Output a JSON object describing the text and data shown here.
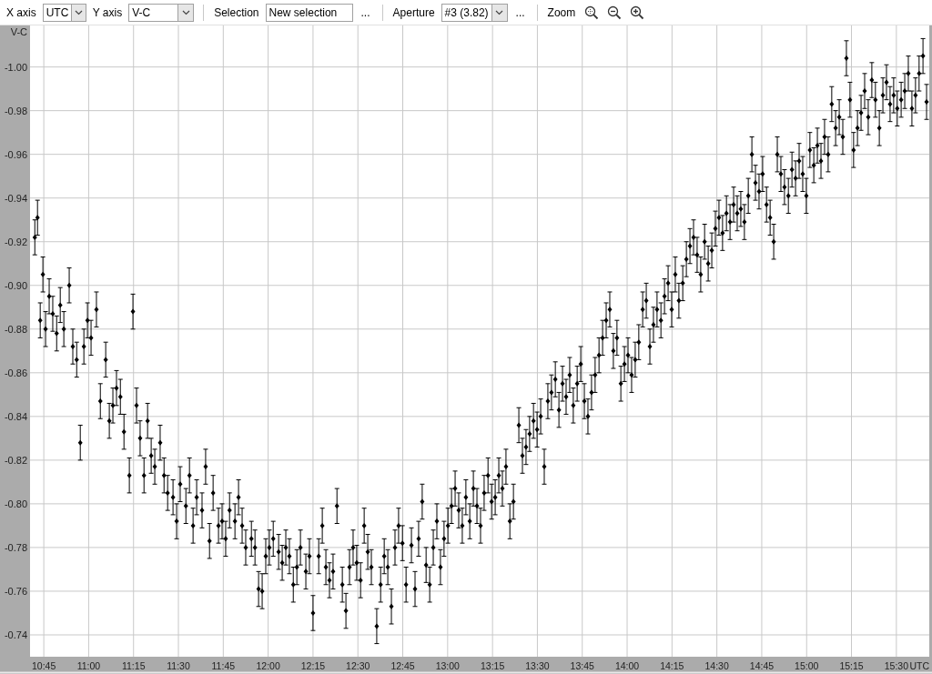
{
  "toolbar": {
    "x_axis": {
      "label": "X axis",
      "value": "UTC"
    },
    "y_axis": {
      "label": "Y axis",
      "value": "V-C"
    },
    "selection": {
      "label": "Selection",
      "value": "New selection",
      "more": "..."
    },
    "aperture": {
      "label": "Aperture",
      "value": "#3 (3.82)",
      "more": "..."
    },
    "zoom": {
      "label": "Zoom"
    }
  },
  "chart": {
    "chart_data": {
      "type": "scatter",
      "xlabel": "UTC",
      "ylabel": "V-C",
      "xlim": [
        640.4,
        941
      ],
      "ylim": [
        -0.73,
        -1.019
      ],
      "grid": true,
      "xticks": [
        {
          "value": 645,
          "label": "10:45"
        },
        {
          "value": 660,
          "label": "11:00"
        },
        {
          "value": 675,
          "label": "11:15"
        },
        {
          "value": 690,
          "label": "11:30"
        },
        {
          "value": 705,
          "label": "11:45"
        },
        {
          "value": 720,
          "label": "12:00"
        },
        {
          "value": 735,
          "label": "12:15"
        },
        {
          "value": 750,
          "label": "12:30"
        },
        {
          "value": 765,
          "label": "12:45"
        },
        {
          "value": 780,
          "label": "13:00"
        },
        {
          "value": 795,
          "label": "13:15"
        },
        {
          "value": 810,
          "label": "13:30"
        },
        {
          "value": 825,
          "label": "13:45"
        },
        {
          "value": 840,
          "label": "14:00"
        },
        {
          "value": 855,
          "label": "14:15"
        },
        {
          "value": 870,
          "label": "14:30"
        },
        {
          "value": 885,
          "label": "14:45"
        },
        {
          "value": 900,
          "label": "15:00"
        },
        {
          "value": 915,
          "label": "15:15"
        },
        {
          "value": 930,
          "label": "15:30"
        }
      ],
      "yticks": [
        {
          "value": -1.0,
          "label": "-1.00"
        },
        {
          "value": -0.98,
          "label": "-0.98"
        },
        {
          "value": -0.96,
          "label": "-0.96"
        },
        {
          "value": -0.94,
          "label": "-0.94"
        },
        {
          "value": -0.92,
          "label": "-0.92"
        },
        {
          "value": -0.9,
          "label": "-0.90"
        },
        {
          "value": -0.88,
          "label": "-0.88"
        },
        {
          "value": -0.86,
          "label": "-0.86"
        },
        {
          "value": -0.84,
          "label": "-0.84"
        },
        {
          "value": -0.82,
          "label": "-0.82"
        },
        {
          "value": -0.8,
          "label": "-0.80"
        },
        {
          "value": -0.78,
          "label": "-0.78"
        },
        {
          "value": -0.76,
          "label": "-0.76"
        },
        {
          "value": -0.74,
          "label": "-0.74"
        }
      ],
      "x": [
        642.0,
        642.9,
        643.8,
        644.7,
        645.6,
        646.8,
        648.0,
        649.3,
        650.5,
        651.7,
        653.5,
        654.7,
        656.0,
        657.2,
        658.4,
        659.6,
        660.8,
        662.6,
        663.9,
        665.7,
        666.9,
        668.1,
        669.3,
        670.6,
        671.8,
        673.6,
        674.8,
        676.0,
        677.2,
        678.5,
        679.7,
        680.9,
        682.1,
        683.9,
        685.2,
        686.4,
        688.2,
        689.4,
        690.6,
        692.5,
        693.7,
        694.9,
        696.1,
        697.9,
        699.1,
        700.4,
        701.6,
        703.4,
        704.6,
        705.8,
        707.1,
        708.9,
        710.1,
        711.3,
        712.5,
        714.4,
        715.6,
        716.8,
        718.0,
        719.2,
        720.4,
        721.7,
        723.5,
        724.7,
        725.9,
        727.1,
        728.4,
        729.6,
        730.8,
        732.6,
        733.8,
        735.0,
        736.9,
        738.1,
        739.3,
        740.5,
        741.7,
        743.0,
        744.8,
        746.0,
        747.2,
        748.4,
        749.6,
        750.9,
        752.1,
        753.3,
        754.5,
        756.3,
        757.6,
        758.8,
        760.0,
        761.2,
        762.4,
        763.6,
        764.9,
        766.1,
        767.9,
        769.1,
        770.3,
        771.5,
        772.8,
        774.0,
        775.2,
        776.4,
        777.6,
        778.8,
        780.1,
        781.3,
        782.5,
        783.7,
        784.9,
        786.1,
        787.4,
        788.6,
        789.8,
        791.0,
        792.2,
        793.5,
        794.7,
        795.9,
        797.1,
        798.3,
        799.5,
        800.8,
        802.0,
        803.8,
        805.0,
        806.2,
        807.4,
        808.7,
        809.9,
        811.1,
        812.3,
        813.5,
        814.7,
        816.0,
        817.2,
        818.4,
        819.6,
        820.8,
        822.0,
        823.3,
        824.5,
        825.7,
        826.9,
        828.1,
        829.3,
        830.6,
        831.8,
        833.0,
        834.2,
        835.4,
        836.6,
        837.9,
        839.1,
        840.3,
        841.5,
        842.7,
        843.9,
        845.2,
        846.4,
        847.6,
        848.8,
        850.0,
        851.3,
        852.5,
        853.7,
        854.9,
        856.1,
        857.3,
        858.6,
        859.8,
        861.0,
        862.2,
        863.4,
        864.6,
        865.9,
        867.1,
        868.3,
        869.5,
        870.7,
        871.9,
        873.2,
        874.4,
        875.6,
        876.8,
        878.0,
        879.2,
        880.5,
        881.7,
        882.9,
        884.1,
        885.3,
        886.6,
        887.8,
        889.0,
        890.2,
        891.4,
        892.6,
        893.9,
        895.1,
        896.3,
        897.5,
        898.7,
        899.9,
        901.1,
        902.4,
        903.6,
        904.8,
        906.0,
        907.2,
        908.4,
        909.7,
        910.9,
        912.1,
        913.3,
        914.5,
        915.7,
        917.0,
        918.2,
        919.4,
        920.6,
        921.8,
        923.0,
        924.3,
        925.5,
        926.7,
        927.9,
        929.1,
        930.3,
        931.6,
        932.8,
        934.0,
        935.2,
        936.4,
        937.6,
        938.9,
        940.1
      ],
      "series": [
        {
          "color": "#000000",
          "errors": [
            0.008,
            0.008,
            0.008,
            0.008,
            0.008,
            0.008,
            0.008,
            0.008,
            0.008,
            0.008,
            0.008,
            0.008,
            0.008,
            0.008,
            0.008,
            0.008,
            0.008,
            0.008,
            0.008,
            0.008,
            0.008,
            0.008,
            0.008,
            0.008,
            0.008,
            0.008,
            0.008,
            0.008,
            0.008,
            0.008,
            0.008,
            0.008,
            0.008,
            0.008,
            0.008,
            0.008,
            0.008,
            0.008,
            0.008,
            0.008,
            0.008,
            0.008,
            0.008,
            0.008,
            0.008,
            0.008,
            0.008,
            0.008,
            0.008,
            0.008,
            0.008,
            0.008,
            0.008,
            0.008,
            0.008,
            0.008,
            0.008,
            0.008,
            0.008,
            0.008,
            0.008,
            0.008,
            0.008,
            0.008,
            0.008,
            0.008,
            0.008,
            0.008,
            0.008,
            0.008,
            0.008,
            0.008,
            0.008,
            0.008,
            0.008,
            0.008,
            0.008,
            0.008,
            0.008,
            0.008,
            0.008,
            0.008,
            0.008,
            0.008,
            0.008,
            0.008,
            0.008,
            0.008,
            0.008,
            0.008,
            0.008,
            0.008,
            0.008,
            0.008,
            0.008,
            0.008,
            0.008,
            0.008,
            0.008,
            0.008,
            0.008,
            0.008,
            0.008,
            0.008,
            0.008,
            0.008,
            0.008,
            0.008,
            0.008,
            0.008,
            0.008,
            0.008,
            0.008,
            0.008,
            0.008,
            0.008,
            0.008,
            0.008,
            0.008,
            0.008,
            0.008,
            0.008,
            0.008,
            0.008,
            0.008,
            0.008,
            0.008,
            0.008,
            0.008,
            0.008,
            0.008,
            0.008,
            0.008,
            0.008,
            0.008,
            0.008,
            0.008,
            0.008,
            0.008,
            0.008,
            0.008,
            0.008,
            0.008,
            0.008,
            0.008,
            0.008,
            0.008,
            0.008,
            0.008,
            0.008,
            0.008,
            0.008,
            0.008,
            0.008,
            0.008,
            0.008,
            0.008,
            0.008,
            0.008,
            0.008,
            0.008,
            0.008,
            0.008,
            0.008,
            0.008,
            0.008,
            0.008,
            0.008,
            0.008,
            0.008,
            0.008,
            0.008,
            0.008,
            0.008,
            0.008,
            0.008,
            0.008,
            0.008,
            0.008,
            0.008,
            0.008,
            0.008,
            0.008,
            0.008,
            0.008,
            0.008,
            0.008,
            0.008,
            0.008,
            0.008,
            0.008,
            0.008,
            0.008,
            0.008,
            0.008,
            0.008,
            0.008,
            0.008,
            0.008,
            0.008,
            0.008,
            0.008,
            0.008,
            0.008,
            0.008,
            0.008,
            0.008,
            0.008,
            0.008,
            0.008,
            0.008,
            0.008,
            0.008,
            0.008,
            0.008,
            0.008,
            0.008,
            0.008,
            0.008,
            0.008,
            0.008,
            0.008,
            0.008,
            0.008,
            0.008,
            0.008,
            0.008,
            0.008,
            0.008,
            0.008,
            0.008,
            0.008,
            0.008,
            0.008,
            0.008,
            0.008,
            0.008,
            0.008
          ],
          "values": [
            -0.922,
            -0.931,
            -0.884,
            -0.905,
            -0.88,
            -0.895,
            -0.887,
            -0.878,
            -0.891,
            -0.88,
            -0.9,
            -0.872,
            -0.866,
            -0.828,
            -0.872,
            -0.884,
            -0.876,
            -0.889,
            -0.847,
            -0.866,
            -0.838,
            -0.845,
            -0.853,
            -0.849,
            -0.833,
            -0.813,
            -0.888,
            -0.845,
            -0.83,
            -0.813,
            -0.838,
            -0.822,
            -0.817,
            -0.828,
            -0.813,
            -0.805,
            -0.803,
            -0.792,
            -0.809,
            -0.799,
            -0.813,
            -0.79,
            -0.803,
            -0.797,
            -0.817,
            -0.783,
            -0.805,
            -0.79,
            -0.792,
            -0.784,
            -0.797,
            -0.792,
            -0.803,
            -0.79,
            -0.78,
            -0.784,
            -0.78,
            -0.761,
            -0.76,
            -0.776,
            -0.78,
            -0.784,
            -0.778,
            -0.773,
            -0.78,
            -0.776,
            -0.763,
            -0.771,
            -0.78,
            -0.769,
            -0.776,
            -0.75,
            -0.776,
            -0.79,
            -0.771,
            -0.765,
            -0.769,
            -0.799,
            -0.763,
            -0.751,
            -0.771,
            -0.78,
            -0.773,
            -0.765,
            -0.79,
            -0.778,
            -0.771,
            -0.744,
            -0.763,
            -0.776,
            -0.771,
            -0.753,
            -0.78,
            -0.79,
            -0.782,
            -0.763,
            -0.781,
            -0.761,
            -0.784,
            -0.801,
            -0.772,
            -0.763,
            -0.78,
            -0.792,
            -0.771,
            -0.784,
            -0.79,
            -0.799,
            -0.807,
            -0.797,
            -0.79,
            -0.803,
            -0.792,
            -0.807,
            -0.799,
            -0.79,
            -0.805,
            -0.813,
            -0.801,
            -0.803,
            -0.813,
            -0.807,
            -0.817,
            -0.792,
            -0.801,
            -0.836,
            -0.822,
            -0.826,
            -0.832,
            -0.838,
            -0.834,
            -0.84,
            -0.817,
            -0.847,
            -0.851,
            -0.857,
            -0.843,
            -0.855,
            -0.849,
            -0.859,
            -0.845,
            -0.855,
            -0.864,
            -0.847,
            -0.84,
            -0.851,
            -0.859,
            -0.868,
            -0.876,
            -0.884,
            -0.889,
            -0.87,
            -0.876,
            -0.855,
            -0.864,
            -0.868,
            -0.859,
            -0.866,
            -0.874,
            -0.889,
            -0.893,
            -0.872,
            -0.882,
            -0.889,
            -0.884,
            -0.895,
            -0.901,
            -0.889,
            -0.905,
            -0.893,
            -0.901,
            -0.912,
            -0.918,
            -0.922,
            -0.914,
            -0.905,
            -0.92,
            -0.91,
            -0.916,
            -0.926,
            -0.931,
            -0.924,
            -0.933,
            -0.929,
            -0.937,
            -0.933,
            -0.935,
            -0.929,
            -0.941,
            -0.96,
            -0.947,
            -0.943,
            -0.951,
            -0.937,
            -0.931,
            -0.92,
            -0.96,
            -0.951,
            -0.945,
            -0.941,
            -0.953,
            -0.949,
            -0.957,
            -0.951,
            -0.941,
            -0.962,
            -0.955,
            -0.964,
            -0.957,
            -0.968,
            -0.96,
            -0.983,
            -0.972,
            -0.977,
            -0.968,
            -1.004,
            -0.985,
            -0.962,
            -0.972,
            -0.979,
            -0.989,
            -0.977,
            -0.994,
            -0.985,
            -0.972,
            -0.987,
            -0.993,
            -0.983,
            -0.987,
            -0.981,
            -0.985,
            -0.989,
            -0.997,
            -0.981,
            -0.987,
            -0.997,
            -1.005,
            -0.984
          ]
        }
      ]
    }
  }
}
